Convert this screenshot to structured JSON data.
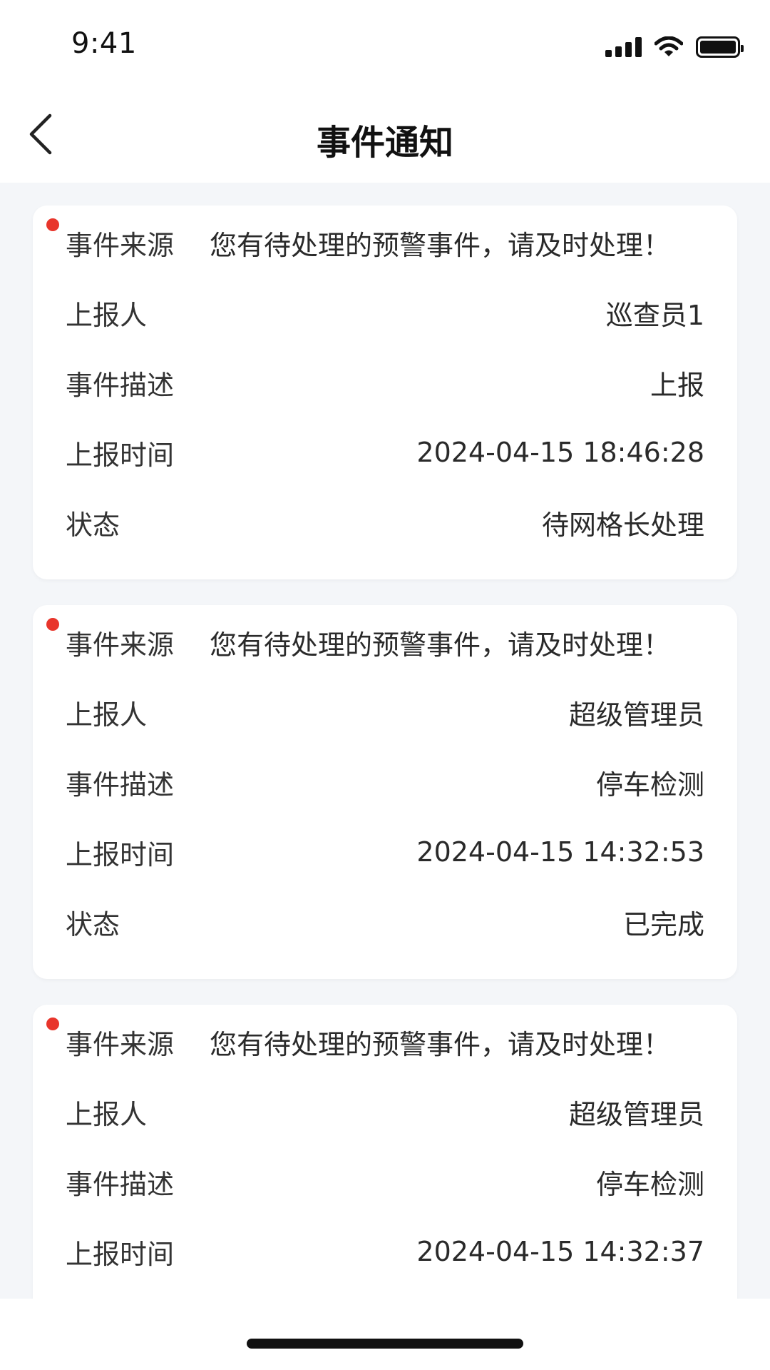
{
  "status_bar": {
    "time": "9:41",
    "icons": [
      "signal-icon",
      "wifi-icon",
      "battery-icon"
    ]
  },
  "nav": {
    "back_icon": "chevron-left-icon",
    "title": "事件通知"
  },
  "colors": {
    "unread_dot": "#e8352b",
    "background": "#f4f6f9",
    "card": "#ffffff"
  },
  "cards": [
    {
      "unread": true,
      "source_label": "事件来源",
      "source_value": "您有待处理的预警事件，请及时处理！",
      "reporter_label": "上报人",
      "reporter_value": "巡查员1",
      "desc_label": "事件描述",
      "desc_value": "上报",
      "time_label": "上报时间",
      "time_value": "2024-04-15 18:46:28",
      "status_label": "状态",
      "status_value": "待网格长处理"
    },
    {
      "unread": true,
      "source_label": "事件来源",
      "source_value": "您有待处理的预警事件，请及时处理！",
      "reporter_label": "上报人",
      "reporter_value": "超级管理员",
      "desc_label": "事件描述",
      "desc_value": "停车检测",
      "time_label": "上报时间",
      "time_value": "2024-04-15 14:32:53",
      "status_label": "状态",
      "status_value": "已完成"
    },
    {
      "unread": true,
      "source_label": "事件来源",
      "source_value": "您有待处理的预警事件，请及时处理！",
      "reporter_label": "上报人",
      "reporter_value": "超级管理员",
      "desc_label": "事件描述",
      "desc_value": "停车检测",
      "time_label": "上报时间",
      "time_value": "2024-04-15 14:32:37"
    }
  ]
}
